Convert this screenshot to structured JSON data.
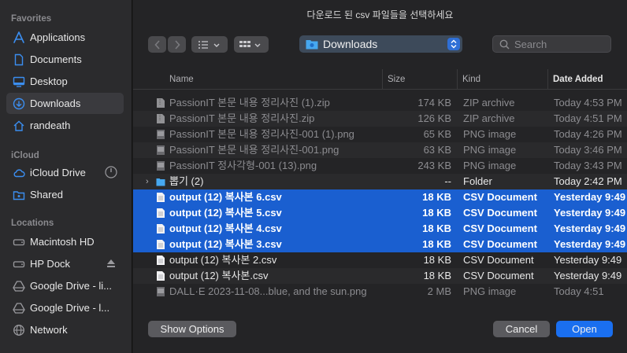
{
  "sidebar": {
    "sections": [
      {
        "title": "Favorites",
        "items": [
          {
            "label": "Applications",
            "icon": "applications-icon"
          },
          {
            "label": "Documents",
            "icon": "document-icon"
          },
          {
            "label": "Desktop",
            "icon": "desktop-icon"
          },
          {
            "label": "Downloads",
            "icon": "downloads-icon",
            "selected": true
          },
          {
            "label": "randeath",
            "icon": "home-icon"
          }
        ]
      },
      {
        "title": "iCloud",
        "items": [
          {
            "label": "iCloud Drive",
            "icon": "cloud-icon",
            "trailing": "progress-circle-icon"
          },
          {
            "label": "Shared",
            "icon": "shared-folder-icon"
          }
        ]
      },
      {
        "title": "Locations",
        "items": [
          {
            "label": "Macintosh HD",
            "icon": "disk-icon"
          },
          {
            "label": "HP Dock",
            "icon": "disk-icon",
            "trailing": "eject-icon"
          },
          {
            "label": "Google Drive - li...",
            "icon": "google-drive-icon"
          },
          {
            "label": "Google Drive - l...",
            "icon": "google-drive-icon"
          },
          {
            "label": "Network",
            "icon": "network-icon"
          }
        ]
      }
    ]
  },
  "dialog": {
    "title": "다운로드 된 csv 파일들을 선택하세요",
    "location": "Downloads",
    "search_placeholder": "Search"
  },
  "columns": {
    "name": "Name",
    "size": "Size",
    "kind": "Kind",
    "date": "Date Added"
  },
  "files": [
    {
      "name": "PassionIT 본문 내용 정리사진 (1).zip",
      "size": "174 KB",
      "kind": "ZIP archive",
      "date": "Today 4:53 PM",
      "type": "zip",
      "state": "dim"
    },
    {
      "name": "PassionIT 본문 내용 정리사진.zip",
      "size": "126 KB",
      "kind": "ZIP archive",
      "date": "Today 4:51 PM",
      "type": "zip",
      "state": "dim"
    },
    {
      "name": "PassionIT 본문 내용 정리사진-001 (1).png",
      "size": "65 KB",
      "kind": "PNG image",
      "date": "Today 4:26 PM",
      "type": "png",
      "state": "dim"
    },
    {
      "name": "PassionIT 본문 내용 정리사진-001.png",
      "size": "63 KB",
      "kind": "PNG image",
      "date": "Today 3:46 PM",
      "type": "png",
      "state": "dim"
    },
    {
      "name": "PassionIT 정사각형-001 (13).png",
      "size": "243 KB",
      "kind": "PNG image",
      "date": "Today 3:43 PM",
      "type": "png",
      "state": "dim"
    },
    {
      "name": "뽑기 (2)",
      "size": "--",
      "kind": "Folder",
      "date": "Today 2:42 PM",
      "type": "folder",
      "state": "bright"
    },
    {
      "name": "output (12) 복사본 6.csv",
      "size": "18 KB",
      "kind": "CSV Document",
      "date": "Yesterday 9:49",
      "type": "csv",
      "state": "sel"
    },
    {
      "name": "output (12) 복사본 5.csv",
      "size": "18 KB",
      "kind": "CSV Document",
      "date": "Yesterday 9:49",
      "type": "csv",
      "state": "sel"
    },
    {
      "name": "output (12) 복사본 4.csv",
      "size": "18 KB",
      "kind": "CSV Document",
      "date": "Yesterday 9:49",
      "type": "csv",
      "state": "sel"
    },
    {
      "name": "output (12) 복사본 3.csv",
      "size": "18 KB",
      "kind": "CSV Document",
      "date": "Yesterday 9:49",
      "type": "csv",
      "state": "sel"
    },
    {
      "name": "output (12) 복사본 2.csv",
      "size": "18 KB",
      "kind": "CSV Document",
      "date": "Yesterday 9:49",
      "type": "csv",
      "state": "bright"
    },
    {
      "name": "output (12) 복사본.csv",
      "size": "18 KB",
      "kind": "CSV Document",
      "date": "Yesterday 9:49",
      "type": "csv",
      "state": "bright"
    },
    {
      "name": "DALL·E 2023-11-08...blue, and the sun.png",
      "size": "2 MB",
      "kind": "PNG image",
      "date": "Today 4:51",
      "type": "png",
      "state": "dim"
    }
  ],
  "buttons": {
    "options": "Show Options",
    "cancel": "Cancel",
    "open": "Open"
  },
  "colors": {
    "accent": "#1a6ff0",
    "selection": "#1a5fd0",
    "sidebar_icon": "#3b8ef0"
  }
}
